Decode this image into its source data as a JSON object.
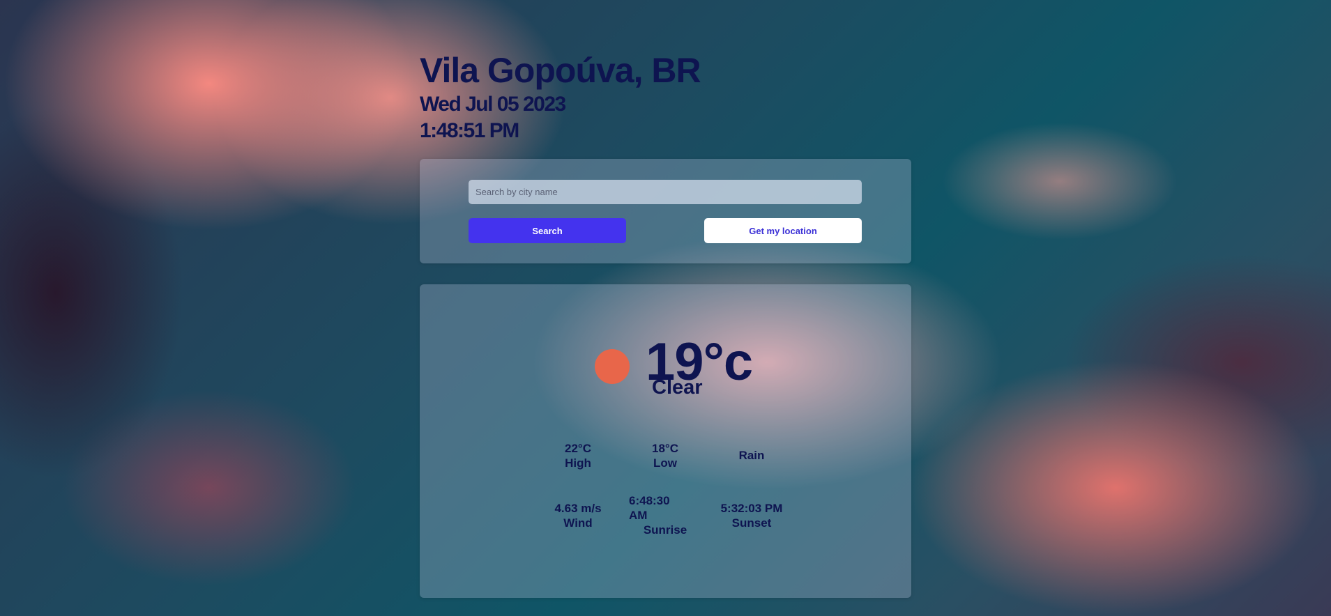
{
  "location": {
    "city": "Vila Gopoúva, BR",
    "date": "Wed Jul 05 2023",
    "time": "1:48:51 PM"
  },
  "search": {
    "placeholder": "Search by city name",
    "search_label": "Search",
    "location_label": "Get my location"
  },
  "current": {
    "icon": "sun-icon",
    "icon_color": "#e8664a",
    "temperature": "19°c",
    "condition": "Clear"
  },
  "details": {
    "high": {
      "value": "22°C",
      "label": "High"
    },
    "low": {
      "value": "18°C",
      "label": "Low"
    },
    "rain": {
      "label": "Rain"
    },
    "wind": {
      "value": "4.63 m/s",
      "label": "Wind"
    },
    "sunrise": {
      "value_line1": "6:48:30",
      "value_line2": "AM",
      "label": "Sunrise"
    },
    "sunset": {
      "value": "5:32:03 PM",
      "label": "Sunset"
    }
  },
  "colors": {
    "text_primary": "#0e1450",
    "accent_button": "#4433ee",
    "secondary_button_text": "#3a2fd6"
  }
}
